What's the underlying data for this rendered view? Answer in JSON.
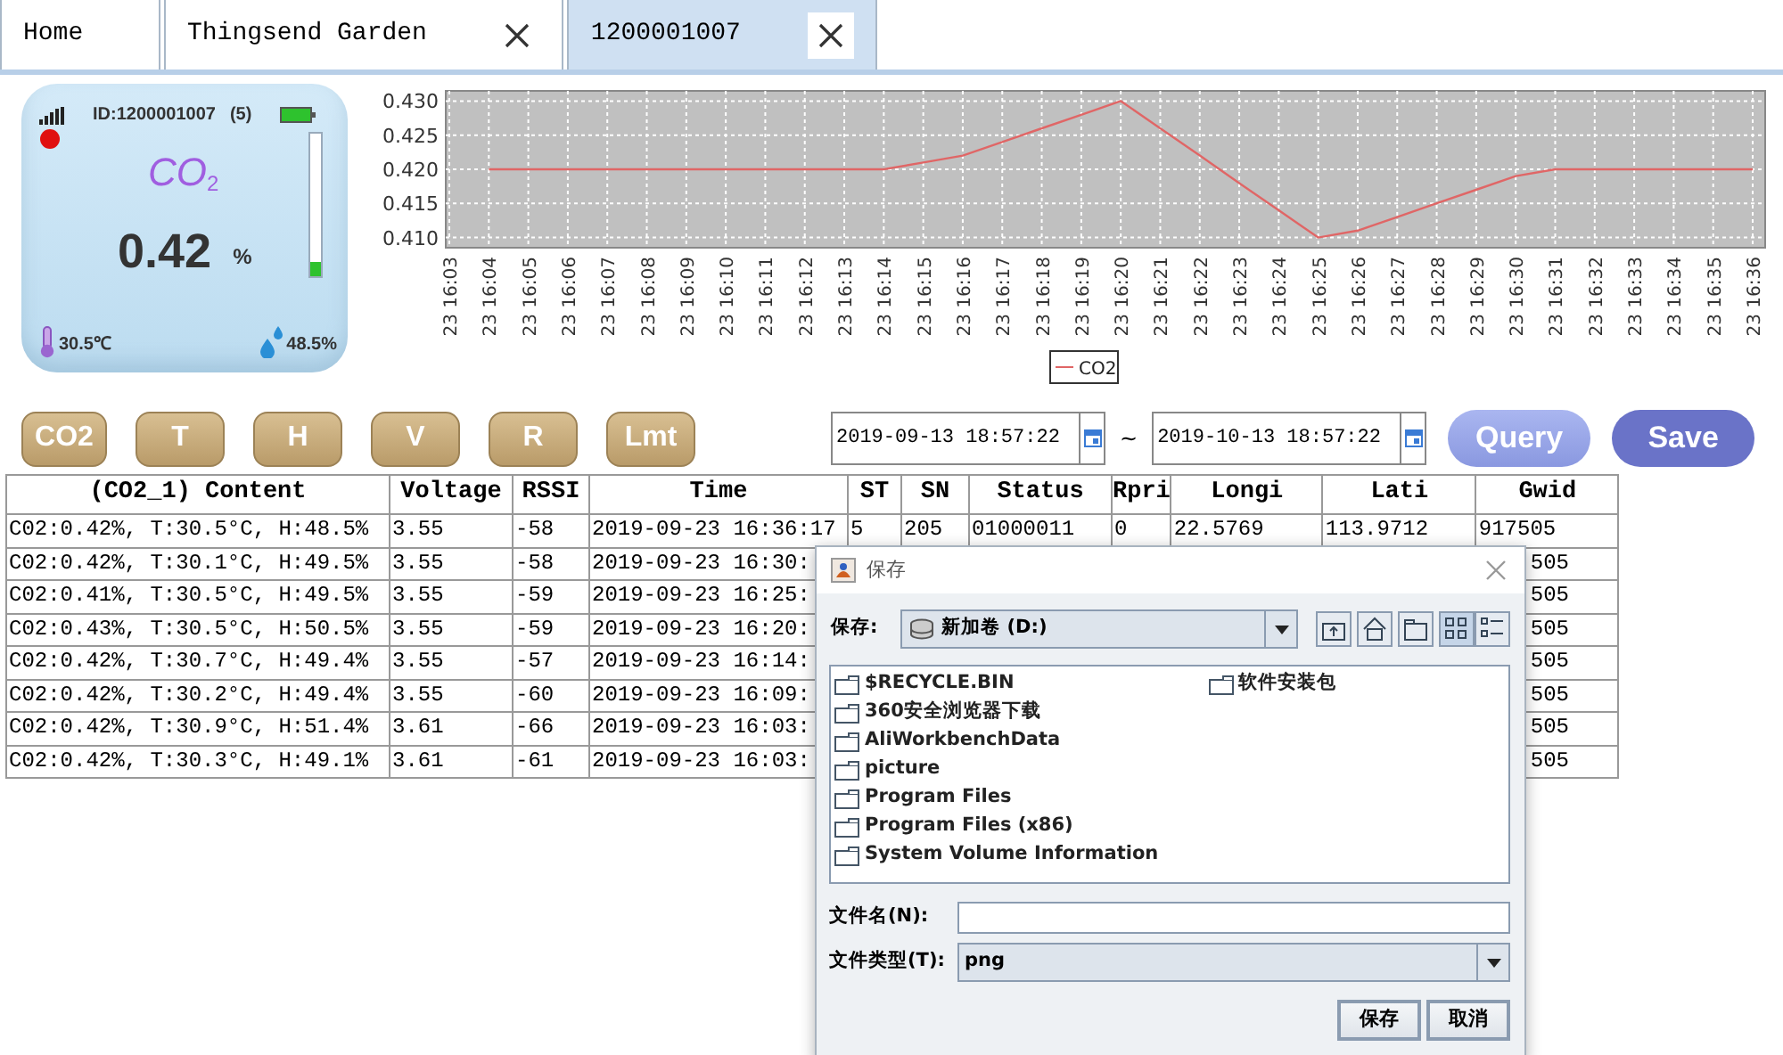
{
  "tabs": [
    {
      "label": "Home",
      "closable": false,
      "selected": false
    },
    {
      "label": "Thingsend Garden",
      "closable": true,
      "selected": false
    },
    {
      "label": "1200001007",
      "closable": true,
      "selected": true
    }
  ],
  "device": {
    "id": "ID:1200001007",
    "count": "(5)",
    "alarm": true,
    "gas": "CO$_{2}$",
    "value": "0.42",
    "unit": "%",
    "level": 0.1,
    "temperature": "30.5℃",
    "humidity": "48.5%"
  },
  "chart": {
    "chart_data": {
      "type": "line",
      "grid": true,
      "ylim": [
        0.4085,
        0.4315
      ],
      "yticks": [
        {
          "value": 0.41,
          "label": "0.410"
        },
        {
          "value": 0.415,
          "label": "0.415"
        },
        {
          "value": 0.42,
          "label": "0.420"
        },
        {
          "value": 0.425,
          "label": "0.425"
        },
        {
          "value": 0.43,
          "label": "0.430"
        }
      ],
      "categories": [
        "23 16:03",
        "23 16:04",
        "23 16:05",
        "23 16:06",
        "23 16:07",
        "23 16:08",
        "23 16:09",
        "23 16:10",
        "23 16:11",
        "23 16:12",
        "23 16:13",
        "23 16:14",
        "23 16:15",
        "23 16:16",
        "23 16:17",
        "23 16:18",
        "23 16:19",
        "23 16:20",
        "23 16:21",
        "23 16:22",
        "23 16:23",
        "23 16:24",
        "23 16:25",
        "23 16:26",
        "23 16:27",
        "23 16:28",
        "23 16:29",
        "23 16:30",
        "23 16:31",
        "23 16:32",
        "23 16:33",
        "23 16:34",
        "23 16:35",
        "23 16:36"
      ],
      "series": [
        {
          "name": "CO2",
          "color": "#e06666",
          "values": [
            null,
            0.42,
            0.42,
            0.42,
            0.42,
            0.42,
            0.42,
            0.42,
            0.42,
            0.42,
            0.42,
            0.42,
            0.421,
            0.422,
            0.424,
            0.426,
            0.428,
            0.43,
            0.426,
            0.422,
            0.418,
            0.414,
            0.41,
            0.411,
            0.413,
            0.415,
            0.417,
            0.419,
            0.42,
            0.42,
            0.42,
            0.42,
            0.42,
            0.42
          ]
        }
      ]
    }
  },
  "sensor_buttons": [
    "CO2",
    "T",
    "H",
    "V",
    "R",
    "Lmt"
  ],
  "date_range": {
    "start": "2019-09-13 18:57:22",
    "separator": "~",
    "end": "2019-10-13 18:57:22"
  },
  "actions": [
    {
      "label": "Query",
      "kind": "query"
    },
    {
      "label": "Save",
      "kind": "save"
    }
  ],
  "table": {
    "columns": [
      "(CO2_1) Content",
      "Voltage",
      "RSSI",
      "Time",
      "ST",
      "SN",
      "Status",
      "Rpri",
      "Longi",
      "Lati",
      "Gwid"
    ],
    "rows": [
      [
        "C02:0.42%, T:30.5°C, H:48.5%",
        "3.55",
        "-58",
        "2019-09-23 16:36:17",
        "5",
        "205",
        "01000011",
        "0",
        "22.5769",
        "113.9712",
        "917505"
      ],
      [
        "C02:0.42%, T:30.1°C, H:49.5%",
        "3.55",
        "-58",
        "2019-09-23 16:30:",
        null,
        null,
        null,
        null,
        null,
        null,
        "505"
      ],
      [
        "C02:0.41%, T:30.5°C, H:49.5%",
        "3.55",
        "-59",
        "2019-09-23 16:25:",
        null,
        null,
        null,
        null,
        null,
        null,
        "505"
      ],
      [
        "C02:0.43%, T:30.5°C, H:50.5%",
        "3.55",
        "-59",
        "2019-09-23 16:20:",
        null,
        null,
        null,
        null,
        null,
        null,
        "505"
      ],
      [
        "C02:0.42%, T:30.7°C, H:49.4%",
        "3.55",
        "-57",
        "2019-09-23 16:14:",
        null,
        null,
        null,
        null,
        null,
        null,
        "505"
      ],
      [
        "C02:0.42%, T:30.2°C, H:49.4%",
        "3.55",
        "-60",
        "2019-09-23 16:09:",
        null,
        null,
        null,
        null,
        null,
        null,
        "505"
      ],
      [
        "C02:0.42%, T:30.9°C, H:51.4%",
        "3.61",
        "-66",
        "2019-09-23 16:03:",
        null,
        null,
        null,
        null,
        null,
        null,
        "505"
      ],
      [
        "C02:0.42%, T:30.3°C, H:49.1%",
        "3.61",
        "-61",
        "2019-09-23 16:03:",
        null,
        null,
        null,
        null,
        null,
        null,
        "505"
      ]
    ]
  },
  "dialog": {
    "title": "保存",
    "save_in_label": "保存:",
    "location": "新加卷 (D:)",
    "tools": [
      {
        "kind": "up",
        "selected": false
      },
      {
        "kind": "home",
        "selected": false
      },
      {
        "kind": "new-folder",
        "selected": false
      },
      {
        "kind": "list",
        "selected": true
      },
      {
        "kind": "details",
        "selected": false
      }
    ],
    "files": [
      "$RECYCLE.BIN",
      "360安全浏览器下载",
      "AliWorkbenchData",
      "picture",
      "Program Files",
      "Program Files (x86)",
      "System Volume Information",
      "软件安装包"
    ],
    "file_name_label": "文件名(N):",
    "file_type_label": "文件类型(T):",
    "file_type": "png",
    "buttons": [
      "保存",
      "取消"
    ]
  }
}
